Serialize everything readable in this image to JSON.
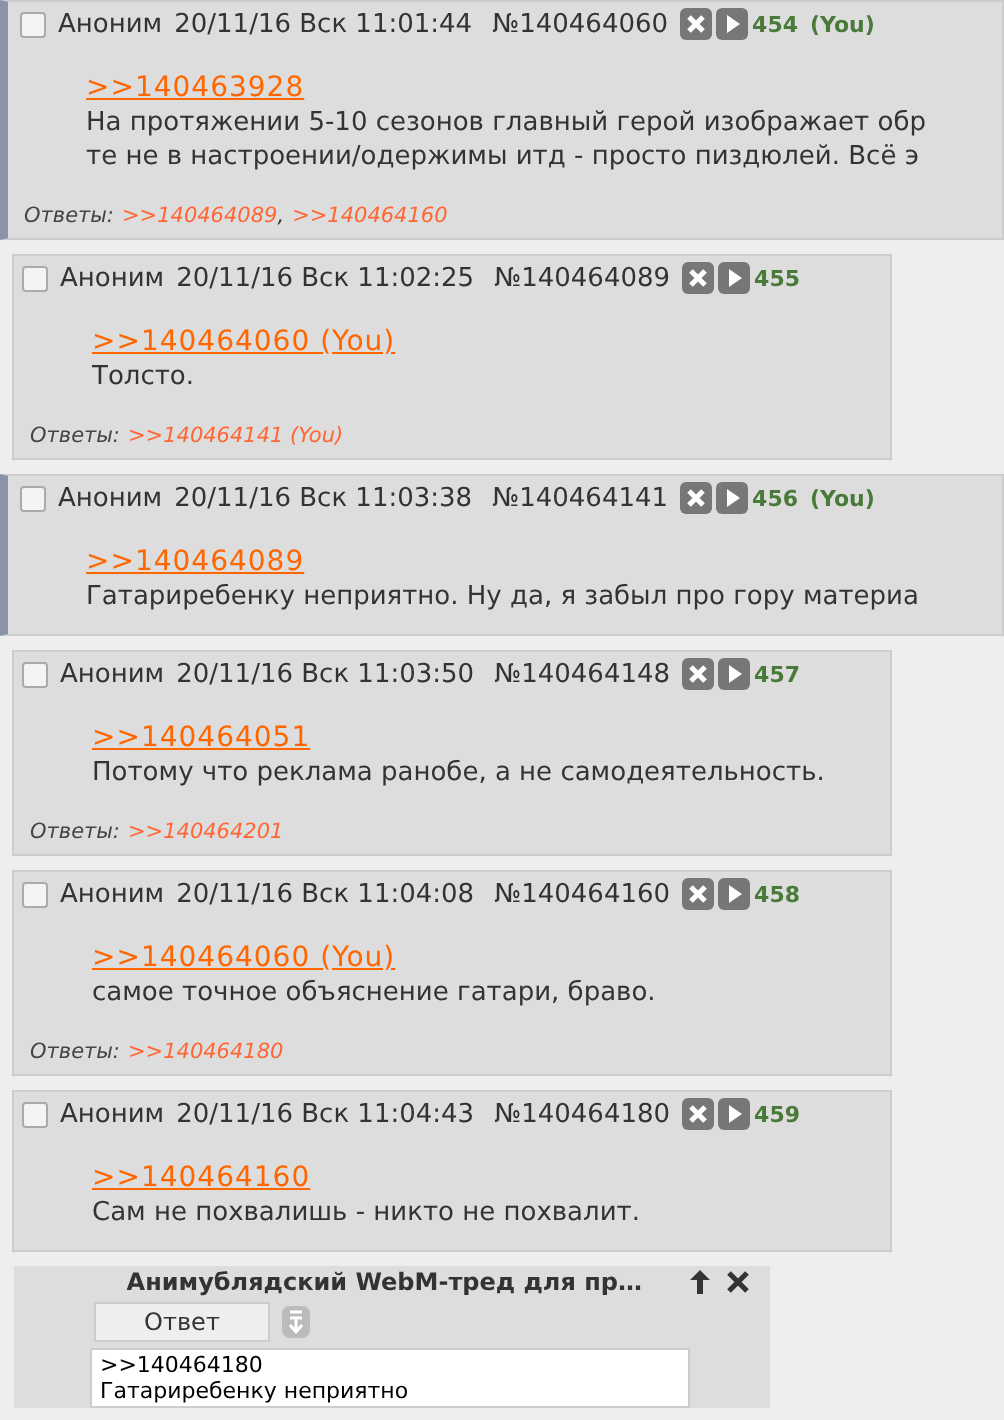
{
  "posts": [
    {
      "own": true,
      "name": "Аноним",
      "date": "20/11/16 Вск 11:01:44",
      "number": "№140464060",
      "counter": "454",
      "you": "(You)",
      "quote": ">>140463928",
      "body": [
        "На протяжении 5-10 сезонов главный герой изображает обр",
        "те не в настроении/одержимы итд - просто пиздюлей. Всё э"
      ],
      "replies_label": "Ответы:",
      "replies": [
        ">>140464089",
        ">>140464160"
      ],
      "reply_separator": ","
    },
    {
      "own": false,
      "name": "Аноним",
      "date": "20/11/16 Вск 11:02:25",
      "number": "№140464089",
      "counter": "455",
      "quote": ">>140464060 (You)",
      "body": [
        "Толсто."
      ],
      "replies_label": "Ответы:",
      "replies": [
        ">>140464141 (You)"
      ]
    },
    {
      "own": true,
      "name": "Аноним",
      "date": "20/11/16 Вск 11:03:38",
      "number": "№140464141",
      "counter": "456",
      "you": "(You)",
      "quote": ">>140464089",
      "body": [
        "Гатариребенку неприятно. Ну да, я забыл про гору материа"
      ]
    },
    {
      "own": false,
      "name": "Аноним",
      "date": "20/11/16 Вск 11:03:50",
      "number": "№140464148",
      "counter": "457",
      "quote": ">>140464051",
      "body": [
        "Потому что реклама ранобе, а не самодеятельность."
      ],
      "replies_label": "Ответы:",
      "replies": [
        ">>140464201"
      ]
    },
    {
      "own": false,
      "name": "Аноним",
      "date": "20/11/16 Вск 11:04:08",
      "number": "№140464160",
      "counter": "458",
      "quote": ">>140464060 (You)",
      "body": [
        "самое точное объяснение гатари, браво."
      ],
      "replies_label": "Ответы:",
      "replies": [
        ">>140464180"
      ]
    },
    {
      "own": false,
      "name": "Аноним",
      "date": "20/11/16 Вск 11:04:43",
      "number": "№140464180",
      "counter": "459",
      "quote": ">>140464160",
      "body": [
        "Сам не похвалишь - никто не похвалит."
      ]
    }
  ],
  "reply_form": {
    "title": "Анимублядский WebM-тред для пр…",
    "button": "Ответ",
    "value": ">>140464180\nГатариребенку неприятно"
  }
}
